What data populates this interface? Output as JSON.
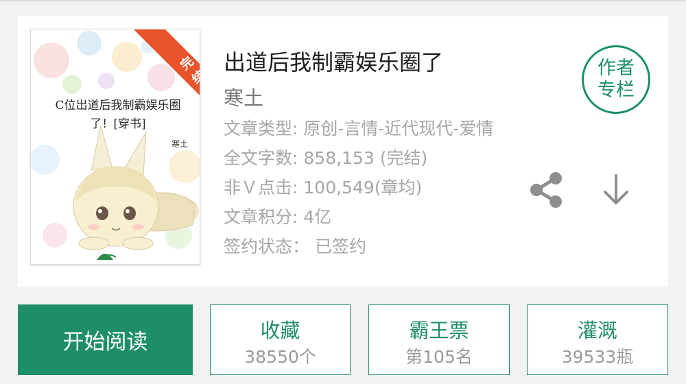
{
  "book": {
    "title": "出道后我制霸娱乐圈了",
    "author": "寒土",
    "cover": {
      "title": "C位出道后我制霸娱乐圈了！[穿书]",
      "author": "寒土",
      "badge": "完结"
    },
    "meta": [
      {
        "key": "文章类型:",
        "value": "原创-言情-近代现代-爱情"
      },
      {
        "key": "全文字数:",
        "value": "858,153 (完结)"
      },
      {
        "key": "非Ｖ点击:",
        "value": "100,549(章均)"
      },
      {
        "key": "文章积分:",
        "value": "4亿"
      },
      {
        "key": "签约状态：",
        "value": "已签约"
      }
    ]
  },
  "author_column": {
    "label": "作者专栏"
  },
  "icons": {
    "share": "share-icon",
    "download": "download-arrow-icon"
  },
  "actions": {
    "read": "开始阅读",
    "stats": [
      {
        "label": "收藏",
        "value": "38550个"
      },
      {
        "label": "霸王票",
        "value": "第105名"
      },
      {
        "label": "灌溉",
        "value": "39533瓶"
      }
    ]
  },
  "colors": {
    "accent": "#1e8e69",
    "meta_text": "#a6a6a6",
    "badge": "#e8532b"
  }
}
